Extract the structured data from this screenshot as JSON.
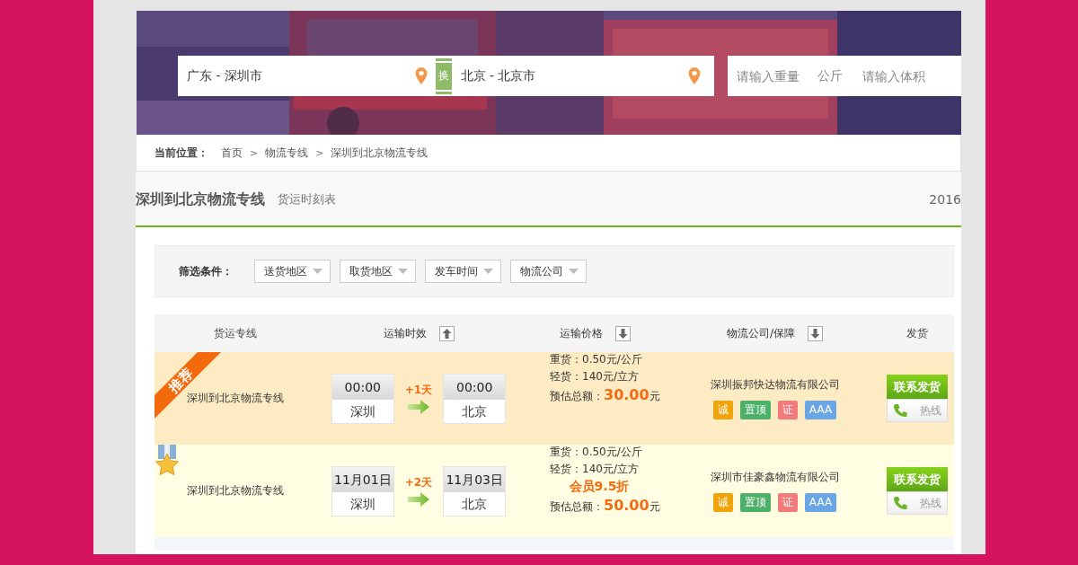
{
  "search": {
    "from": "广东 - 深圳市",
    "swap": "换",
    "to": "北京 - 北京市",
    "weight_placeholder": "请输入重量",
    "unit": "公斤",
    "volume_placeholder": "请输入体积"
  },
  "breadcrumb": {
    "label": "当前位置：",
    "items": [
      {
        "kind": "link",
        "text": "首页"
      },
      {
        "kind": "sep",
        "text": ">"
      },
      {
        "kind": "link",
        "text": "物流专线"
      },
      {
        "kind": "sep",
        "text": ">"
      },
      {
        "kind": "link",
        "text": "深圳到北京物流专线"
      }
    ]
  },
  "section": {
    "title": "深圳到北京物流专线",
    "subtitle": "货运时刻表",
    "date": "2016"
  },
  "filters": {
    "label": "筛选条件：",
    "dropdowns": [
      "送货地区",
      "取货地区",
      "发车时间",
      "物流公司"
    ]
  },
  "table": {
    "columns": [
      {
        "label": "货运专线",
        "sortable": false
      },
      {
        "label": "运输时效",
        "sortable": true,
        "ascending": true
      },
      {
        "label": "运输价格",
        "sortable": true,
        "ascending": false
      },
      {
        "label": "物流公司/保障",
        "sortable": true,
        "ascending": false
      },
      {
        "label": "发货",
        "sortable": false
      }
    ],
    "rows": [
      {
        "kind": "recommended",
        "badge": "推荐",
        "route": "深圳到北京物流专线",
        "depart_time": "00:00",
        "depart_city": "深圳",
        "days": "+1天",
        "arrive_time": "00:00",
        "arrive_city": "北京",
        "heavy": "重货：0.50元/公斤",
        "light": "轻货：140元/立方",
        "estimate_label": "预估总额：",
        "estimate": "30.00",
        "estimate_unit": "元",
        "company": "深圳振邦快达物流有限公司",
        "tags": [
          {
            "text": "诚",
            "color": "#f0a30a"
          },
          {
            "text": "置顶",
            "color": "#4caf6a"
          },
          {
            "text": "证",
            "color": "#f27a7a"
          },
          {
            "text": "AAA",
            "color": "#6aa6e6"
          }
        ],
        "contact": "联系发货",
        "hotline": "热线"
      },
      {
        "kind": "medal",
        "route": "深圳到北京物流专线",
        "depart_time": "11月01日",
        "depart_city": "深圳",
        "days": "+2天",
        "arrive_time": "11月03日",
        "arrive_city": "北京",
        "heavy": "重货：0.50元/公斤",
        "light": "轻货：140元/立方",
        "discount": "会员9.5折",
        "estimate_label": "预估总额：",
        "estimate": "50.00",
        "estimate_unit": "元",
        "company": "深圳市佳豪鑫物流有限公司",
        "tags": [
          {
            "text": "诚",
            "color": "#f0a30a"
          },
          {
            "text": "置顶",
            "color": "#4caf6a"
          },
          {
            "text": "证",
            "color": "#f27a7a"
          },
          {
            "text": "AAA",
            "color": "#6aa6e6"
          }
        ],
        "contact": "联系发货",
        "hotline": "热线"
      }
    ]
  }
}
